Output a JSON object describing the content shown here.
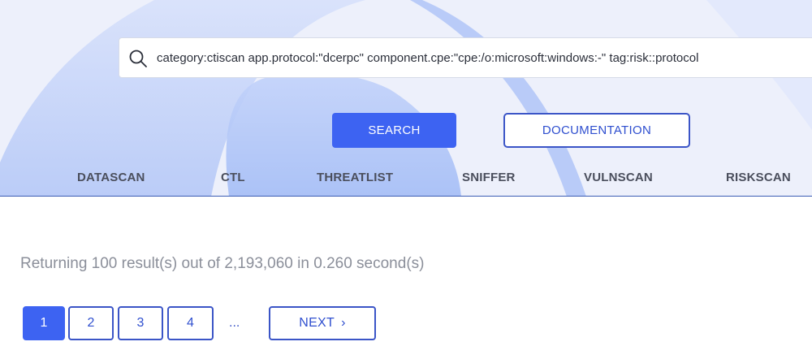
{
  "search": {
    "query": "category:ctiscan app.protocol:\"dcerpc\" component.cpe:\"cpe:/o:microsoft:windows:-\" tag:risk::protocol"
  },
  "buttons": {
    "search": "SEARCH",
    "documentation": "DOCUMENTATION"
  },
  "nav": {
    "tabs": [
      "DATASCAN",
      "CTL",
      "THREATLIST",
      "SNIFFER",
      "VULNSCAN",
      "RISKSCAN"
    ]
  },
  "results": {
    "summary": "Returning 100 result(s) out of 2,193,060 in 0.260 second(s)"
  },
  "pagination": {
    "pages": [
      "1",
      "2",
      "3",
      "4"
    ],
    "active_page": "1",
    "ellipsis": "...",
    "next_label": "NEXT",
    "next_chevron": "›"
  },
  "colors": {
    "primary": "#3d63f2",
    "outline": "#3b55c7",
    "hero_bg": "#edf0fb",
    "muted_text": "#8b8f9a"
  },
  "icons": {
    "search": "search-icon"
  }
}
